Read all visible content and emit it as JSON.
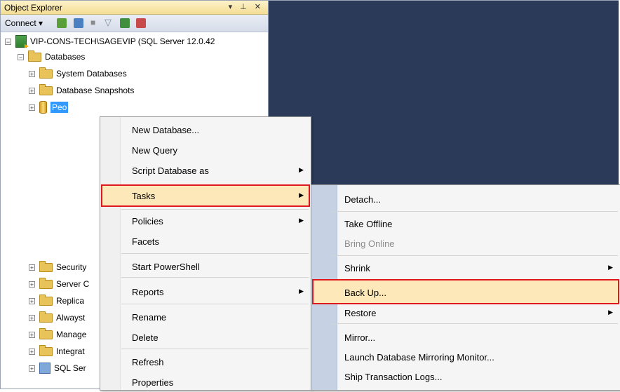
{
  "object_explorer": {
    "title": "Object Explorer",
    "title_buttons": "▾ ⊥ ✕",
    "connect_label": "Connect ▾"
  },
  "tree": {
    "server": "VIP-CONS-TECH\\SAGEVIP (SQL Server 12.0.42",
    "databases": "Databases",
    "system_databases": "System Databases",
    "database_snapshots": "Database Snapshots",
    "selected_db": "Peo",
    "security": "Security",
    "server_objects": "Server C",
    "replication": "Replica",
    "alwayson": "Alwayst",
    "management": "Manage",
    "integration": "Integrat",
    "sql_agent": "SQL Ser"
  },
  "context_menu": {
    "items": [
      {
        "label": "New Database..."
      },
      {
        "label": "New Query"
      },
      {
        "label": "Script Database as",
        "submenu": true
      },
      {
        "label": "Tasks",
        "submenu": true,
        "highlighted": true
      },
      {
        "label": "Policies",
        "submenu": true
      },
      {
        "label": "Facets"
      },
      {
        "label": "Start PowerShell"
      },
      {
        "label": "Reports",
        "submenu": true
      },
      {
        "label": "Rename"
      },
      {
        "label": "Delete"
      },
      {
        "label": "Refresh"
      },
      {
        "label": "Properties"
      }
    ]
  },
  "tasks_submenu": {
    "items": [
      {
        "label": "Detach..."
      },
      {
        "label": "Take Offline"
      },
      {
        "label": "Bring Online",
        "disabled": true
      },
      {
        "label": "Shrink",
        "submenu": true
      },
      {
        "label": "Back Up...",
        "highlighted": true
      },
      {
        "label": "Restore",
        "submenu": true
      },
      {
        "label": "Mirror..."
      },
      {
        "label": "Launch Database Mirroring Monitor..."
      },
      {
        "label": "Ship Transaction Logs..."
      }
    ]
  },
  "colors": {
    "workspace": "#2b3a58",
    "highlight_border": "#e0191f",
    "highlight_fill": "#fce8b8",
    "selection": "#3399ff"
  }
}
